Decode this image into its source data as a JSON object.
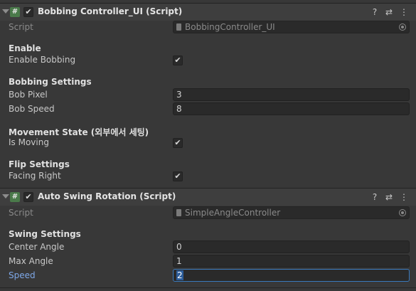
{
  "components": [
    {
      "title": "Bobbing Controller_UI (Script)",
      "script_label": "Script",
      "script_value": "BobbingController_UI",
      "sections": {
        "enable": {
          "header": "Enable",
          "field_label": "Enable Bobbing"
        },
        "bobbing": {
          "header": "Bobbing Settings",
          "bob_pixel_label": "Bob Pixel",
          "bob_pixel_value": "3",
          "bob_speed_label": "Bob Speed",
          "bob_speed_value": "8"
        },
        "movement": {
          "header": "Movement State (외부에서 세팅)",
          "field_label": "Is Moving"
        },
        "flip": {
          "header": "Flip Settings",
          "field_label": "Facing Right"
        }
      }
    },
    {
      "title": "Auto Swing Rotation (Script)",
      "script_label": "Script",
      "script_value": "SimpleAngleController",
      "sections": {
        "swing": {
          "header": "Swing Settings",
          "center_angle_label": "Center Angle",
          "center_angle_value": "0",
          "max_angle_label": "Max Angle",
          "max_angle_value": "1",
          "speed_label": "Speed",
          "speed_value": "2"
        }
      }
    }
  ],
  "icons": {
    "foldout": "triangle-down",
    "script": "#",
    "enabled_check": "✔",
    "help": "?",
    "presets": "⇄",
    "menu": "⋮"
  },
  "colors": {
    "panel_bg": "#383838",
    "header_bg": "#3e3e3e",
    "field_bg": "#2a2a2a",
    "focus_border": "#3a79bb",
    "focus_label": "#7ea8e8"
  }
}
